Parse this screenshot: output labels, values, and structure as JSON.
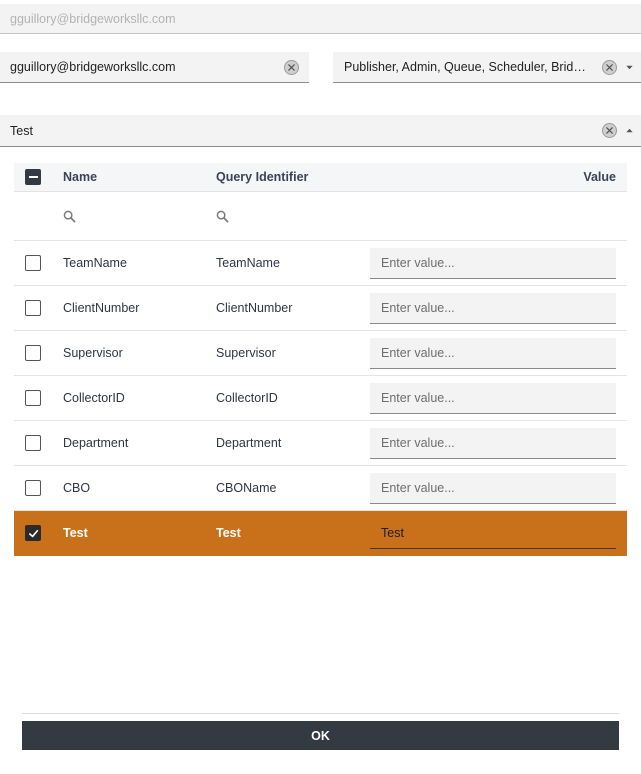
{
  "top_field": {
    "value": "gguillory@bridgeworksllc.com"
  },
  "email_field": {
    "value": "gguillory@bridgeworksllc.com"
  },
  "roles_field": {
    "value": "Publisher, Admin, Queue, Scheduler, Bridgit ..."
  },
  "query_field": {
    "value": "Test"
  },
  "grid": {
    "headers": {
      "name": "Name",
      "query_identifier": "Query Identifier",
      "value": "Value"
    },
    "placeholder": "Enter value...",
    "rows": [
      {
        "name": "TeamName",
        "query_identifier": "TeamName",
        "value": "",
        "checked": false
      },
      {
        "name": "ClientNumber",
        "query_identifier": "ClientNumber",
        "value": "",
        "checked": false
      },
      {
        "name": "Supervisor",
        "query_identifier": "Supervisor",
        "value": "",
        "checked": false
      },
      {
        "name": "CollectorID",
        "query_identifier": "CollectorID",
        "value": "",
        "checked": false
      },
      {
        "name": "Department",
        "query_identifier": "Department",
        "value": "",
        "checked": false
      },
      {
        "name": "CBO",
        "query_identifier": "CBOName",
        "value": "",
        "checked": false
      },
      {
        "name": "Test",
        "query_identifier": "Test",
        "value": "Test",
        "checked": true
      }
    ]
  },
  "ok_button": {
    "label": "OK"
  },
  "colors": {
    "selected_row": "#c8701a",
    "button_bg": "#333a42",
    "header_bg": "#f5f6f8"
  },
  "icons": {
    "clear": "clear-icon",
    "caret_down": "caret-down-icon",
    "caret_up": "caret-up-icon",
    "search": "search-icon",
    "check": "check-icon"
  }
}
